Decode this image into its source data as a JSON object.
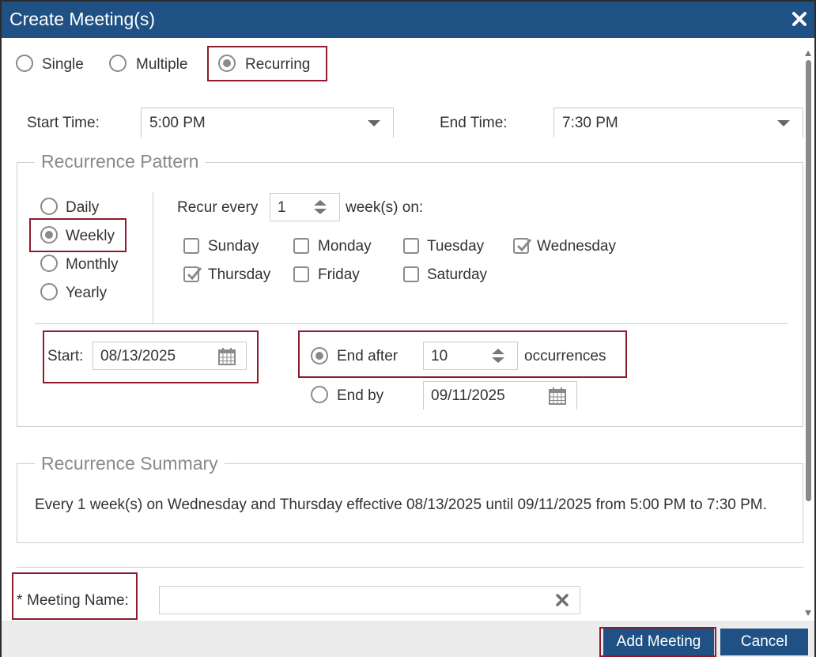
{
  "dialog": {
    "title": "Create Meeting(s)",
    "close_icon": "close-icon"
  },
  "meeting_type": {
    "options": [
      "Single",
      "Multiple",
      "Recurring"
    ],
    "selected": "Recurring"
  },
  "time": {
    "start_label": "Start Time:",
    "start_value": "5:00 PM",
    "end_label": "End Time:",
    "end_value": "7:30 PM"
  },
  "recurrence_pattern": {
    "legend": "Recurrence Pattern",
    "frequencies": [
      "Daily",
      "Weekly",
      "Monthly",
      "Yearly"
    ],
    "selected_frequency": "Weekly",
    "recur_every_label": "Recur every",
    "recur_every_value": "1",
    "weeks_on_label": "week(s) on:",
    "days": [
      {
        "label": "Sunday",
        "checked": false
      },
      {
        "label": "Monday",
        "checked": false
      },
      {
        "label": "Tuesday",
        "checked": false
      },
      {
        "label": "Wednesday",
        "checked": true
      },
      {
        "label": "Thursday",
        "checked": true
      },
      {
        "label": "Friday",
        "checked": false
      },
      {
        "label": "Saturday",
        "checked": false
      }
    ]
  },
  "range": {
    "start_label": "Start:",
    "start_value": "08/13/2025",
    "end_after_label": "End after",
    "end_after_value": "10",
    "occurrences_label": "occurrences",
    "end_by_label": "End by",
    "end_by_value": "09/11/2025",
    "selected_end": "End after"
  },
  "recurrence_summary": {
    "legend": "Recurrence Summary",
    "text": "Every 1 week(s) on Wednesday and Thursday effective 08/13/2025 until 09/11/2025 from 5:00 PM to 7:30 PM."
  },
  "meeting_name": {
    "required_mark": "*",
    "label": "Meeting Name:",
    "value": ""
  },
  "footer": {
    "add_label": "Add Meeting",
    "cancel_label": "Cancel"
  },
  "colors": {
    "header": "#1f5184",
    "highlight": "#8b1d2e",
    "control_gray": "#8a8a8a"
  }
}
